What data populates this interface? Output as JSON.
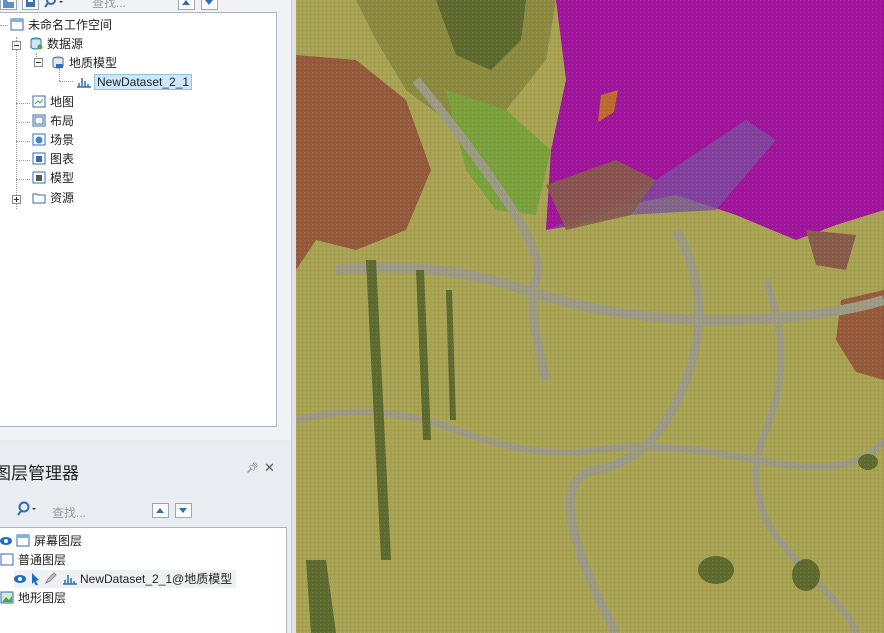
{
  "workspace_manager": {
    "search_placeholder": "查找...",
    "tree": {
      "workspace": "未命名工作空间",
      "datasources": "数据源",
      "datasource": "地质模型",
      "dataset": "NewDataset_2_1",
      "maps": "地图",
      "layouts": "布局",
      "scenes": "场景",
      "charts": "图表",
      "models": "模型",
      "resources": "资源"
    }
  },
  "layer_manager": {
    "title": "图层管理器",
    "search_placeholder": "查找...",
    "tree": {
      "screen_layers": "屏幕图层",
      "normal_layers": "普通图层",
      "layer": "NewDataset_2_1@地质模型",
      "terrain_layers": "地形图层"
    }
  },
  "colors": {
    "map_background": "#a9a34f",
    "purple_unit": "#a4139f",
    "brown_unit": "#96593a",
    "dark_green_unit": "#5d6b2c",
    "light_green_unit": "#7ba23a",
    "grey_drainage": "#9c9a82",
    "selection": "#cce8ff"
  }
}
